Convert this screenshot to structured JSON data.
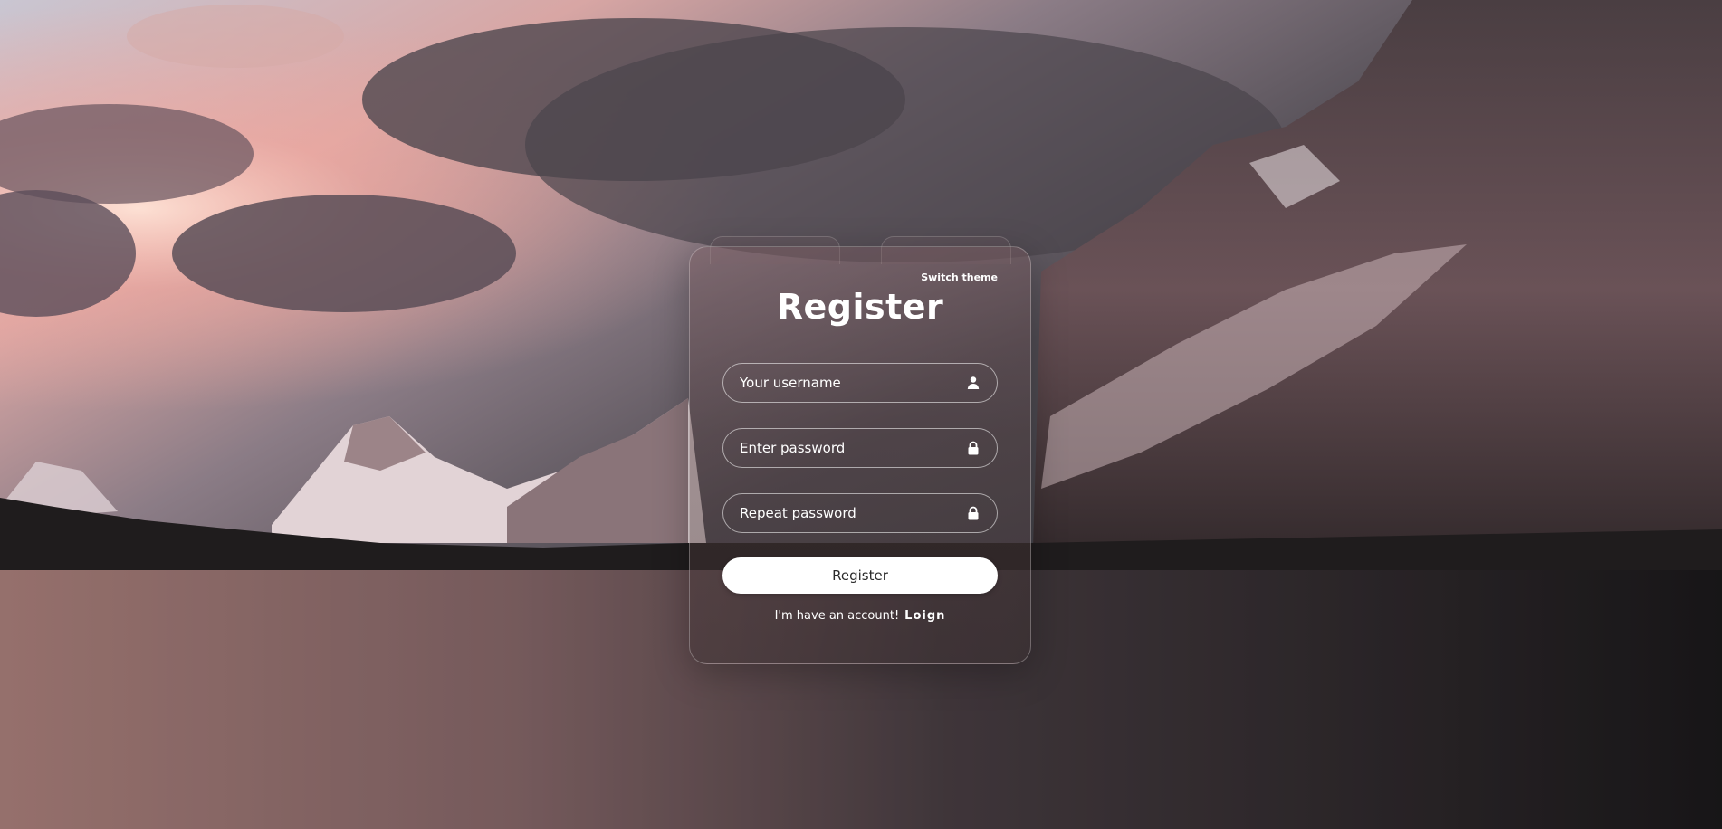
{
  "header": {
    "switch_theme": "Switch theme"
  },
  "form": {
    "title": "Register",
    "username": {
      "placeholder": "Your username",
      "value": "",
      "icon": "user-icon"
    },
    "password": {
      "placeholder": "Enter password",
      "value": "",
      "icon": "lock-icon"
    },
    "repeat_password": {
      "placeholder": "Repeat password",
      "value": "",
      "icon": "lock-icon"
    },
    "submit_label": "Register",
    "account_prompt": "I'm have an account!",
    "login_label": "Loign"
  },
  "colors": {
    "text": "#ffffff",
    "button_bg": "#ffffff",
    "button_text": "#2a2a2a"
  }
}
